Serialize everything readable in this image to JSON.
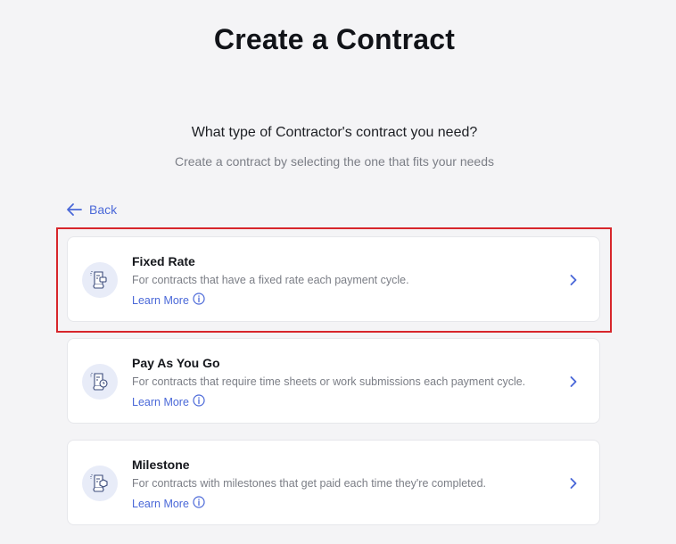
{
  "header": {
    "title": "Create a Contract",
    "question": "What type of Contractor's contract you need?",
    "subtitle": "Create a contract by selecting the one that fits your needs"
  },
  "nav": {
    "back_label": "Back",
    "back_icon": "arrow-left-icon"
  },
  "contract_types": [
    {
      "name": "Fixed Rate",
      "description": "For contracts that have a fixed rate each payment cycle.",
      "learn_more": "Learn More",
      "icon": "contract-fixed-rate-icon",
      "selected": true
    },
    {
      "name": "Pay As You Go",
      "description": "For contracts that require time sheets or work submissions each payment cycle.",
      "learn_more": "Learn More",
      "icon": "contract-pay-as-you-go-icon",
      "selected": false
    },
    {
      "name": "Milestone",
      "description": "For contracts with milestones that get paid each time they're completed.",
      "learn_more": "Learn More",
      "icon": "contract-milestone-icon",
      "selected": false
    }
  ],
  "colors": {
    "accent": "#4a68d8",
    "highlight": "#d7262b",
    "background": "#f4f4f6"
  }
}
